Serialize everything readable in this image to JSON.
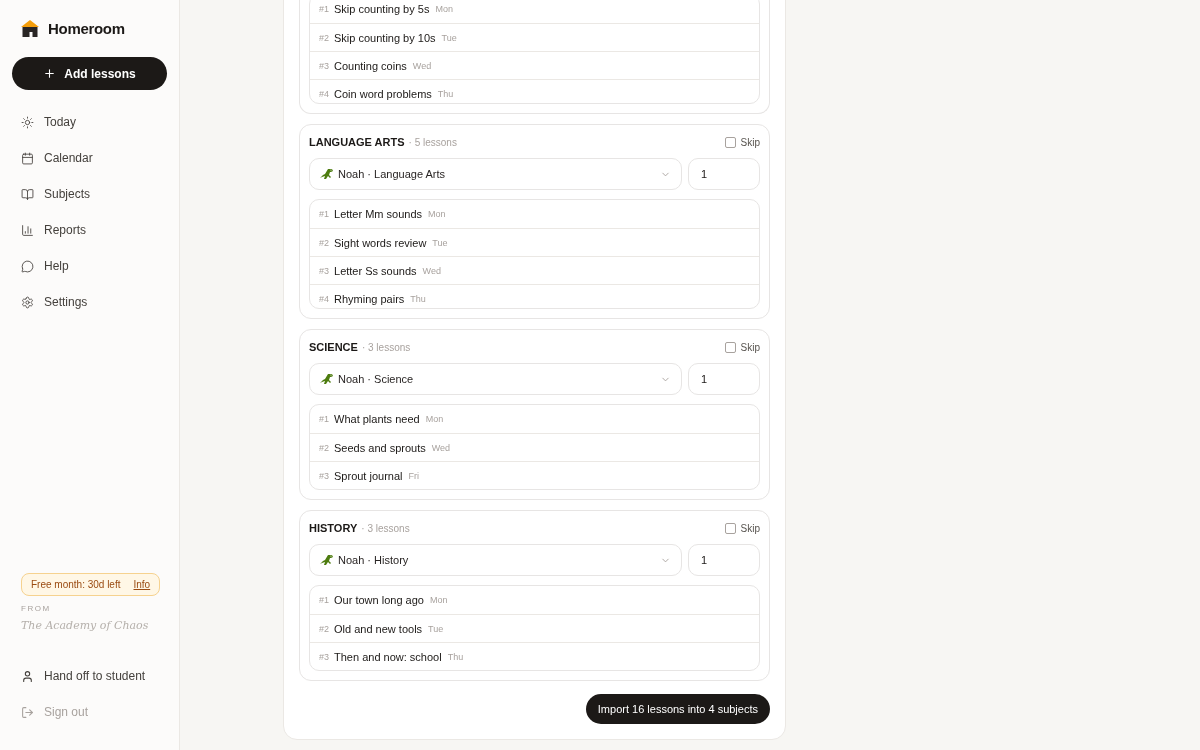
{
  "sidebar": {
    "brand": "Homeroom",
    "add_button": "Add lessons",
    "nav": [
      {
        "label": "Today",
        "selected": false
      },
      {
        "label": "Calendar",
        "selected": false
      },
      {
        "label": "Subjects",
        "selected": false
      },
      {
        "label": "Reports",
        "selected": false
      },
      {
        "label": "Help",
        "selected": false
      },
      {
        "label": "Settings",
        "selected": false
      }
    ],
    "trial": {
      "text": "Free month: 30d left",
      "link": "Info"
    },
    "from_label": "FROM",
    "signature": "The Academy of Chaos",
    "footer": [
      {
        "label": "Hand off to student",
        "kind": "user",
        "disabled": false
      },
      {
        "label": "Sign out",
        "kind": "signout",
        "disabled": true
      }
    ]
  },
  "import_card": {
    "partial_section": {
      "lessons": [
        {
          "num": "#1",
          "title": "Skip counting by 5s",
          "day": "Mon"
        },
        {
          "num": "#2",
          "title": "Skip counting by 10s",
          "day": "Tue"
        },
        {
          "num": "#3",
          "title": "Counting coins",
          "day": "Wed"
        },
        {
          "num": "#4",
          "title": "Coin word problems",
          "day": "Thu"
        }
      ]
    },
    "subjects": [
      {
        "name": "LANGUAGE ARTS",
        "count": "· 5 lessons",
        "skip_label": "Skip",
        "skip": false,
        "target": "Noah · Language Arts",
        "per_day": "1",
        "lessons": [
          {
            "num": "#1",
            "title": "Letter Mm sounds",
            "day": "Mon"
          },
          {
            "num": "#2",
            "title": "Sight words review",
            "day": "Tue"
          },
          {
            "num": "#3",
            "title": "Letter Ss sounds",
            "day": "Wed"
          },
          {
            "num": "#4",
            "title": "Rhyming pairs",
            "day": "Thu"
          }
        ]
      },
      {
        "name": "SCIENCE",
        "count": "· 3 lessons",
        "skip_label": "Skip",
        "skip": false,
        "target": "Noah · Science",
        "per_day": "1",
        "lessons": [
          {
            "num": "#1",
            "title": "What plants need",
            "day": "Mon"
          },
          {
            "num": "#2",
            "title": "Seeds and sprouts",
            "day": "Wed"
          },
          {
            "num": "#3",
            "title": "Sprout journal",
            "day": "Fri"
          }
        ]
      },
      {
        "name": "HISTORY",
        "count": "· 3 lessons",
        "skip_label": "Skip",
        "skip": false,
        "target": "Noah · History",
        "per_day": "1",
        "lessons": [
          {
            "num": "#1",
            "title": "Our town long ago",
            "day": "Mon"
          },
          {
            "num": "#2",
            "title": "Old and new tools",
            "day": "Tue"
          },
          {
            "num": "#3",
            "title": "Then and now: school",
            "day": "Thu"
          }
        ]
      }
    ],
    "import_button": "Import 16 lessons into 4 subjects"
  }
}
